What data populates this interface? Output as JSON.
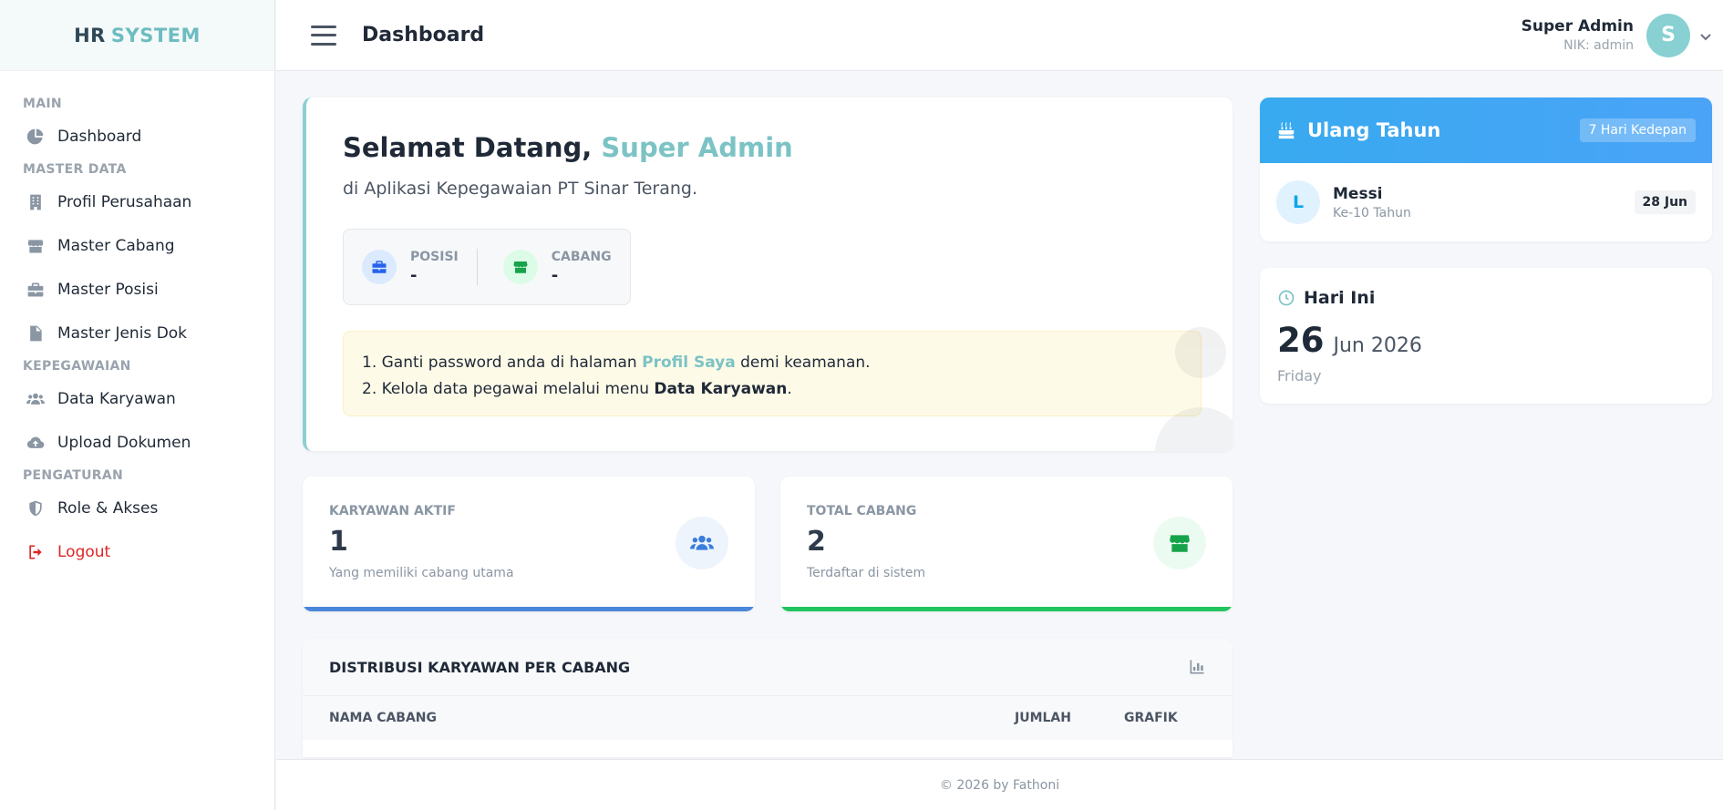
{
  "brand": {
    "part1": "HR",
    "part2": "SYSTEM"
  },
  "sidebar": {
    "sections": [
      {
        "title": "MAIN",
        "items": [
          {
            "label": "Dashboard",
            "icon": "chart-pie-icon"
          }
        ]
      },
      {
        "title": "MASTER DATA",
        "items": [
          {
            "label": "Profil Perusahaan",
            "icon": "building-icon"
          },
          {
            "label": "Master Cabang",
            "icon": "store-icon"
          },
          {
            "label": "Master Posisi",
            "icon": "briefcase-icon"
          },
          {
            "label": "Master Jenis Dok",
            "icon": "file-icon"
          }
        ]
      },
      {
        "title": "KEPEGAWAIAN",
        "items": [
          {
            "label": "Data Karyawan",
            "icon": "users-icon"
          },
          {
            "label": "Upload Dokumen",
            "icon": "cloud-upload-icon"
          }
        ]
      },
      {
        "title": "PENGATURAN",
        "items": [
          {
            "label": "Role & Akses",
            "icon": "shield-icon"
          }
        ]
      }
    ],
    "logout": "Logout"
  },
  "header": {
    "title": "Dashboard",
    "user_name": "Super Admin",
    "user_nik": "NIK: admin",
    "avatar_initial": "S"
  },
  "welcome": {
    "greeting": "Selamat Datang,",
    "name": "Super Admin",
    "subtitle": "di Aplikasi Kepegawaian PT Sinar Terang.",
    "posisi_label": "POSISI",
    "posisi_value": "-",
    "cabang_label": "CABANG",
    "cabang_value": "-",
    "notice_1_prefix": "1. Ganti password anda di halaman ",
    "notice_1_link": "Profil Saya",
    "notice_1_suffix": " demi keamanan.",
    "notice_2_prefix": "2. Kelola data pegawai melalui menu ",
    "notice_2_bold": "Data Karyawan",
    "notice_2_suffix": "."
  },
  "stats": [
    {
      "label": "KARYAWAN AKTIF",
      "value": "1",
      "desc": "Yang memiliki cabang utama",
      "color": "#4a86d9",
      "icon": "users-icon"
    },
    {
      "label": "TOTAL CABANG",
      "value": "2",
      "desc": "Terdaftar di sistem",
      "color": "#22c55e",
      "icon": "store-icon"
    }
  ],
  "distribution": {
    "title": "DISTRIBUSI KARYAWAN PER CABANG",
    "columns": [
      "NAMA CABANG",
      "JUMLAH",
      "GRAFIK"
    ]
  },
  "birthday": {
    "title": "Ulang Tahun",
    "badge": "7 Hari Kedepan",
    "person_initial": "L",
    "person_name": "Messi",
    "person_age": "Ke-10 Tahun",
    "person_date": "28 Jun"
  },
  "today": {
    "title": "Hari Ini",
    "day": "26",
    "month_year": "Jun 2026",
    "weekday": "Friday"
  },
  "footer": {
    "text": "© 2026 by Fathoni"
  }
}
